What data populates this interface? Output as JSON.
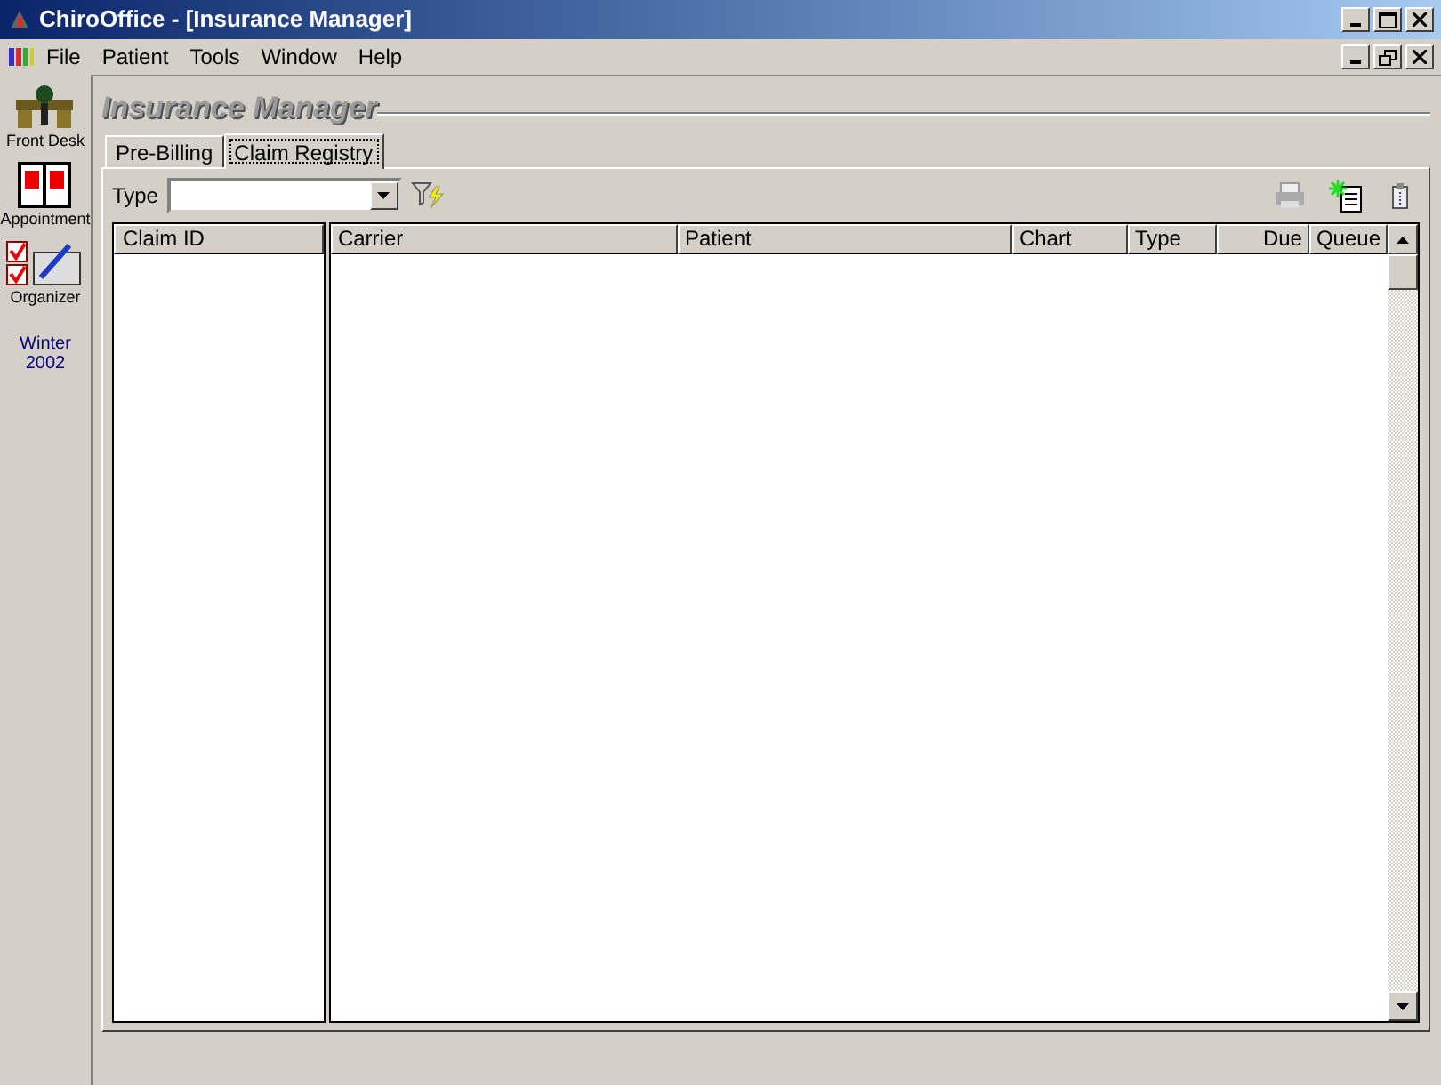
{
  "window": {
    "title": "ChiroOffice - [Insurance Manager]"
  },
  "menu": [
    "File",
    "Patient",
    "Tools",
    "Window",
    "Help"
  ],
  "sidebar": {
    "items": [
      {
        "label": "Front Desk",
        "kind": "desk"
      },
      {
        "label": "Appointment",
        "kind": "calendar"
      },
      {
        "label": "Organizer",
        "kind": "organizer"
      }
    ],
    "edition": [
      "Winter",
      "2002"
    ]
  },
  "heading": "Insurance Manager",
  "tabs": [
    {
      "label": "Pre-Billing",
      "selected": false
    },
    {
      "label": "Claim Registry",
      "selected": true
    }
  ],
  "filter": {
    "label": "Type"
  },
  "claim_list": {
    "column": "Claim ID"
  },
  "table": {
    "columns": [
      {
        "label": "Carrier"
      },
      {
        "label": "Patient"
      },
      {
        "label": "Chart"
      },
      {
        "label": "Type"
      },
      {
        "label": "Due"
      },
      {
        "label": "Queue"
      }
    ]
  }
}
